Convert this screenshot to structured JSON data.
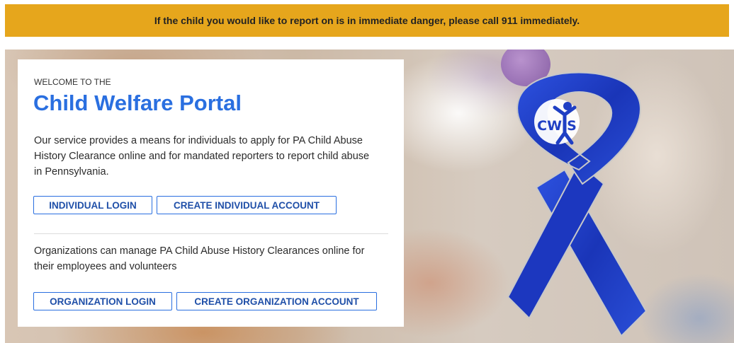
{
  "alert": {
    "message": "If the child you would like to report on is in immediate danger, please call 911 immediately."
  },
  "hero": {
    "ribbon_logo_text": "CWIS",
    "ribbon_color": "#1f3fc4"
  },
  "welcome": {
    "eyebrow": "WELCOME TO THE",
    "title": "Child Welfare Portal",
    "individual_description": "Our service provides a means for individuals to apply for PA Child Abuse History Clearance online and for mandated reporters to report child abuse in Pennsylvania.",
    "individual_login_label": "INDIVIDUAL LOGIN",
    "create_individual_label": "CREATE INDIVIDUAL ACCOUNT",
    "organization_description": "Organizations can manage PA Child Abuse History Clearances online for their employees and volunteers",
    "organization_login_label": "ORGANIZATION LOGIN",
    "create_organization_label": "CREATE ORGANIZATION ACCOUNT"
  },
  "colors": {
    "alert_background": "#e6a61c",
    "title_blue": "#2a6fe0",
    "button_text": "#1f4fa8"
  }
}
